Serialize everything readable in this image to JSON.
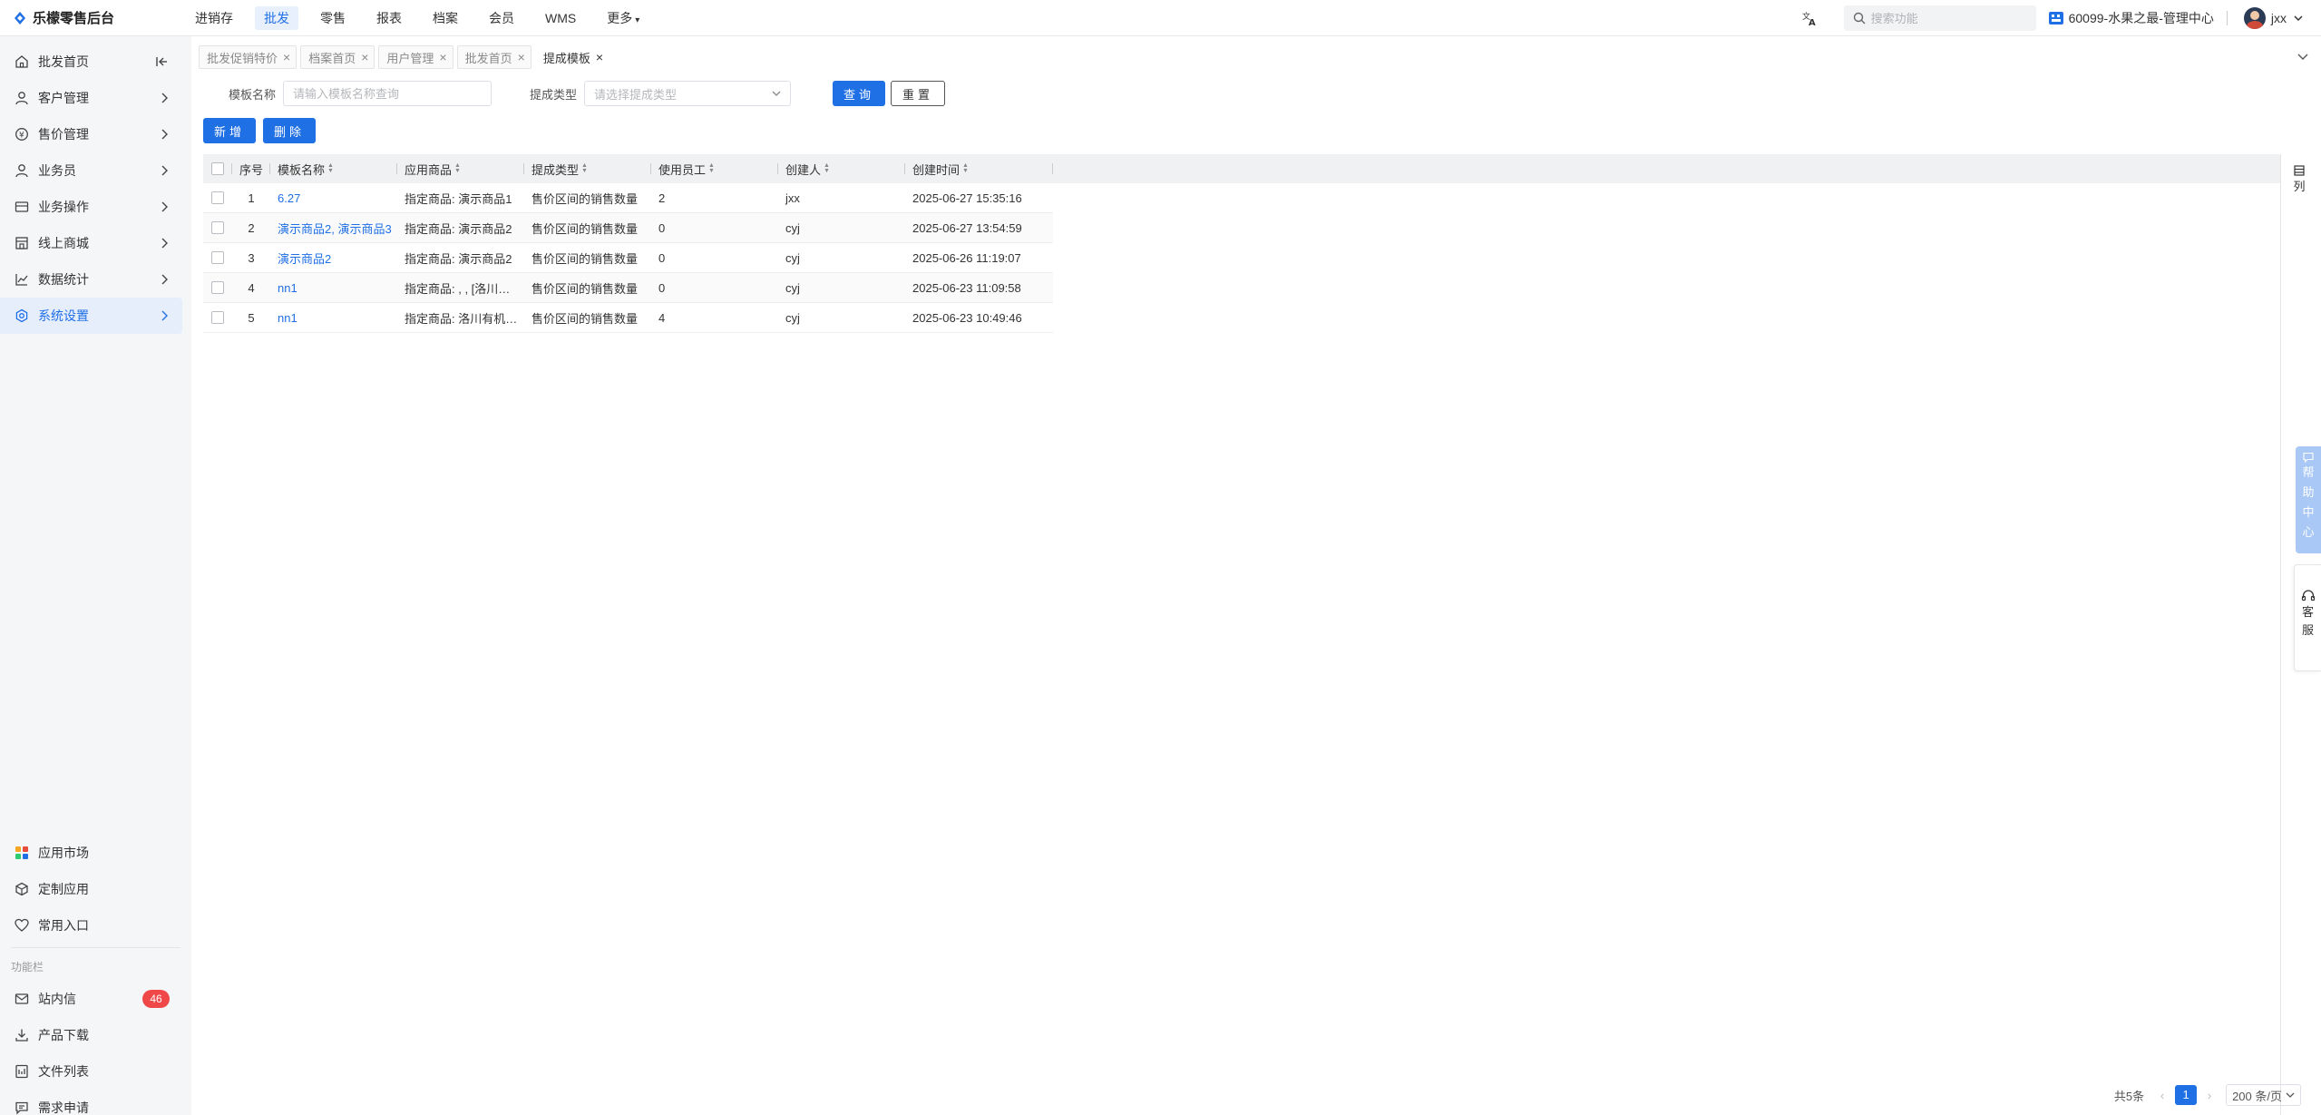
{
  "app": {
    "name": "乐檬零售后台"
  },
  "topnav": [
    {
      "label": "进销存",
      "active": false
    },
    {
      "label": "批发",
      "active": true
    },
    {
      "label": "零售",
      "active": false
    },
    {
      "label": "报表",
      "active": false
    },
    {
      "label": "档案",
      "active": false
    },
    {
      "label": "会员",
      "active": false
    },
    {
      "label": "WMS",
      "active": false
    },
    {
      "label": "更多",
      "active": false
    }
  ],
  "header": {
    "search_placeholder": "搜索功能",
    "org": "60099-水果之最-管理中心",
    "user": "jxx"
  },
  "sidebar": {
    "items": [
      {
        "label": "批发首页",
        "icon": "home-icon"
      },
      {
        "label": "客户管理",
        "icon": "user-icon"
      },
      {
        "label": "售价管理",
        "icon": "price-icon"
      },
      {
        "label": "业务员",
        "icon": "person-icon"
      },
      {
        "label": "业务操作",
        "icon": "operation-icon"
      },
      {
        "label": "线上商城",
        "icon": "store-icon"
      },
      {
        "label": "数据统计",
        "icon": "chart-icon"
      },
      {
        "label": "系统设置",
        "icon": "settings-icon"
      }
    ],
    "bottom": [
      {
        "label": "应用市场"
      },
      {
        "label": "定制应用"
      },
      {
        "label": "常用入口"
      }
    ],
    "section_label": "功能栏",
    "functions": [
      {
        "label": "站内信",
        "badge": "46"
      },
      {
        "label": "产品下载"
      },
      {
        "label": "文件列表"
      },
      {
        "label": "需求申请"
      }
    ]
  },
  "tabs": [
    {
      "label": "批发促销特价",
      "active": false
    },
    {
      "label": "档案首页",
      "active": false
    },
    {
      "label": "用户管理",
      "active": false
    },
    {
      "label": "批发首页",
      "active": false
    },
    {
      "label": "提成模板",
      "active": true
    }
  ],
  "filter": {
    "name_label": "模板名称",
    "name_placeholder": "请输入模板名称查询",
    "type_label": "提成类型",
    "type_placeholder": "请选择提成类型",
    "query_button": "查询",
    "reset_button": "重置"
  },
  "actions": {
    "add_button": "新增",
    "delete_button": "删除"
  },
  "table": {
    "columns": [
      "序号",
      "模板名称",
      "应用商品",
      "提成类型",
      "使用员工",
      "创建人",
      "创建时间"
    ],
    "rows": [
      {
        "idx": "1",
        "name": "6.27",
        "goods": "指定商品: 演示商品1",
        "type": "售价区间的销售数量",
        "staff": "2",
        "creator": "jxx",
        "time": "2025-06-27 15:35:16"
      },
      {
        "idx": "2",
        "name": "演示商品2, 演示商品3",
        "goods": "指定商品: 演示商品2",
        "type": "售价区间的销售数量",
        "staff": "0",
        "creator": "cyj",
        "time": "2025-06-27 13:54:59"
      },
      {
        "idx": "3",
        "name": "演示商品2",
        "goods": "指定商品: 演示商品2",
        "type": "售价区间的销售数量",
        "staff": "0",
        "creator": "cyj",
        "time": "2025-06-26 11:19:07"
      },
      {
        "idx": "4",
        "name": "nn1",
        "goods": "指定商品: , , [洛川苹果]",
        "type": "售价区间的销售数量",
        "staff": "0",
        "creator": "cyj",
        "time": "2025-06-23 11:09:58"
      },
      {
        "idx": "5",
        "name": "nn1",
        "goods": "指定商品: 洛川有机苹果",
        "type": "售价区间的销售数量",
        "staff": "4",
        "creator": "cyj",
        "time": "2025-06-23 10:49:46"
      }
    ],
    "column_toggle": "列"
  },
  "widgets": {
    "help": [
      "帮",
      "助",
      "中",
      "心"
    ],
    "service": [
      "客",
      "服"
    ]
  },
  "pagination": {
    "total": "共5条",
    "current": "1",
    "page_size": "200 条/页"
  },
  "colors": {
    "primary": "#1f6fe5",
    "badge": "#f04848",
    "sidebar_bg": "#f5f6f8"
  }
}
